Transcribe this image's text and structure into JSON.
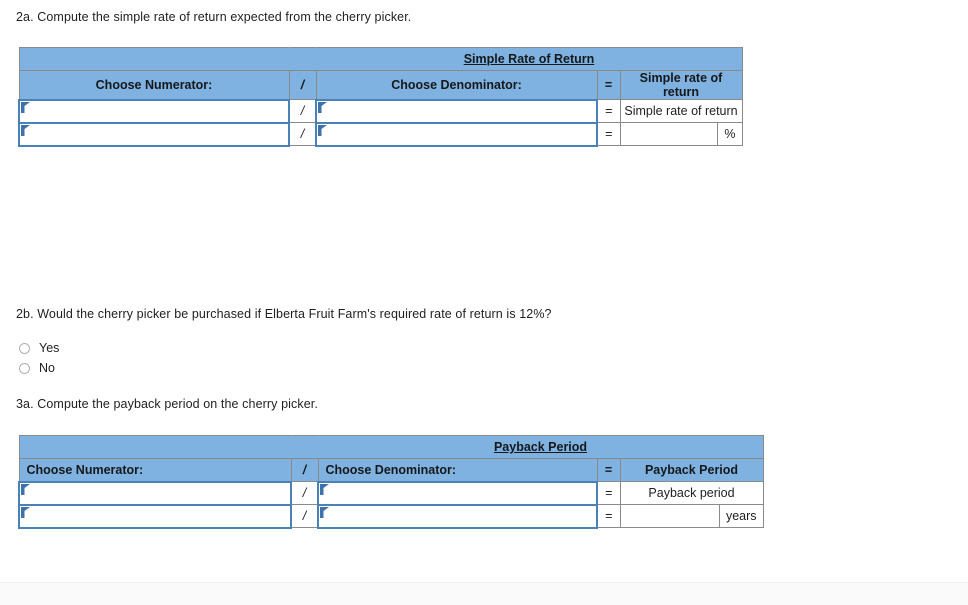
{
  "prompts": {
    "q2a": "2a. Compute the simple rate of return expected from the cherry picker.",
    "q2b": "2b. Would the cherry picker be purchased if Elberta Fruit Farm's required rate of return is 12%?",
    "q3a": "3a. Compute the payback period on the cherry picker."
  },
  "radio_options": [
    {
      "label": "Yes",
      "selected": false
    },
    {
      "label": "No",
      "selected": false
    }
  ],
  "symbols": {
    "slash": "/",
    "equals": "="
  },
  "colors": {
    "header_blue": "#7fb2e0",
    "cell_border": "#8a8a8a",
    "input_border": "#4a82b8",
    "marker_blue": "#3f72ab",
    "text": "#1f1f1f"
  },
  "table_simple_rate_of_return": {
    "title": "Simple Rate of Return",
    "headers": {
      "numerator": "Choose Numerator:",
      "slash": "/",
      "denominator": "Choose Denominator:",
      "equals": "=",
      "result": "Simple rate of return"
    },
    "rows": [
      {
        "numerator": "",
        "slash": "/",
        "denominator": "",
        "equals": "=",
        "result": "Simple rate of return",
        "unit": ""
      },
      {
        "numerator": "",
        "slash": "/",
        "denominator": "",
        "equals": "=",
        "result": "",
        "unit": "%"
      }
    ]
  },
  "table_payback_period": {
    "title": "Payback Period",
    "headers": {
      "numerator": "Choose Numerator:",
      "slash": "/",
      "denominator": "Choose Denominator:",
      "equals": "=",
      "result": "Payback Period"
    },
    "rows": [
      {
        "numerator": "",
        "slash": "/",
        "denominator": "",
        "equals": "=",
        "result": "Payback period",
        "unit": ""
      },
      {
        "numerator": "",
        "slash": "/",
        "denominator": "",
        "equals": "=",
        "result": "",
        "unit": "years"
      }
    ]
  }
}
